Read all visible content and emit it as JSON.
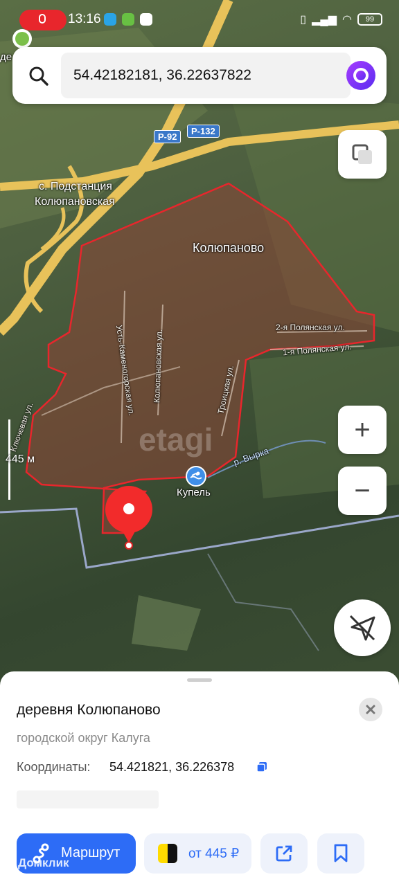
{
  "status_bar": {
    "time": "13:16",
    "battery": "99",
    "icons": [
      "mic-icon",
      "telegram-icon",
      "download-icon",
      "app-icon",
      "vibrate-icon",
      "signal-icon",
      "wifi-icon"
    ]
  },
  "search": {
    "value": "54.42182181, 36.22637822",
    "icon": "search-icon",
    "assistant_icon": "alice-icon"
  },
  "map": {
    "labels": {
      "village": "Колюпаново",
      "station_1": "с. Подстанция",
      "station_2": "Колюпановская",
      "street_1": "2-я Полянская ул.",
      "street_2": "1-я Полянская ул.",
      "street_3": "Усть-Каменогорская ул.",
      "street_4": "Колюпановская ул.",
      "street_5": "Троицкая ул.",
      "street_6": "Ключевая ул.",
      "river": "р. Вырка",
      "poi": "Купель",
      "road_1": "Р-92",
      "road_2": "Р-132",
      "watermark": "etagi",
      "edge_label": "де"
    },
    "scale": "445 м",
    "controls": {
      "zoom_in": "+",
      "zoom_out": "−"
    }
  },
  "place_card": {
    "title": "деревня Колюпаново",
    "subtitle": "городской округ Калуга",
    "coords_label": "Координаты:",
    "coords_value": "54.421821, 36.226378",
    "route_button": "Маршрут",
    "taxi_button": "от 445 ₽"
  },
  "watermark_text": "Домклик",
  "colors": {
    "accent": "#2d6cf6",
    "boundary": "#e8262c"
  }
}
